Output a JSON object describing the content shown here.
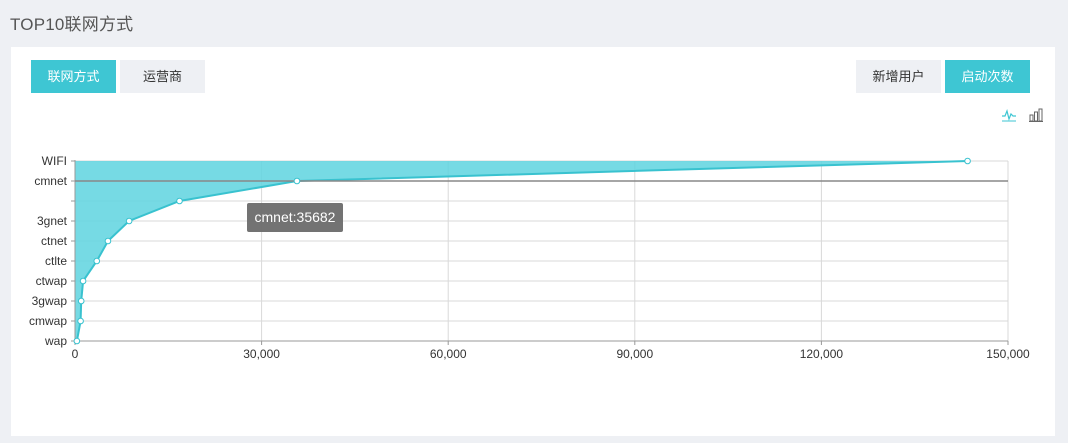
{
  "page": {
    "title": "TOP10联网方式"
  },
  "tabs_left": [
    {
      "label": "联网方式",
      "active": true
    },
    {
      "label": "运营商",
      "active": false
    }
  ],
  "tabs_right": [
    {
      "label": "新增用户",
      "active": false
    },
    {
      "label": "启动次数",
      "active": true
    }
  ],
  "icons": {
    "line": "line-chart-icon",
    "bar": "bar-chart-icon"
  },
  "colors": {
    "accent": "#3ec6d3",
    "area": "#5ed3df",
    "line": "#39c2cf",
    "tooltip_bg": "#6b6b6b"
  },
  "tooltip": {
    "text": "cmnet:35682"
  },
  "chart_data": {
    "type": "area",
    "orientation": "horizontal",
    "categories": [
      "WIFI",
      "cmnet",
      "",
      "3gnet",
      "ctnet",
      "ctlte",
      "ctwap",
      "3gwap",
      "cmwap",
      "wap"
    ],
    "values": [
      143500,
      35682,
      16800,
      8700,
      5300,
      3500,
      1300,
      1000,
      900,
      300
    ],
    "xlim": [
      0,
      150000
    ],
    "xticks": [
      "0",
      "30,000",
      "60,000",
      "90,000",
      "120,000",
      "150,000"
    ],
    "grid": true,
    "highlight": "cmnet"
  }
}
